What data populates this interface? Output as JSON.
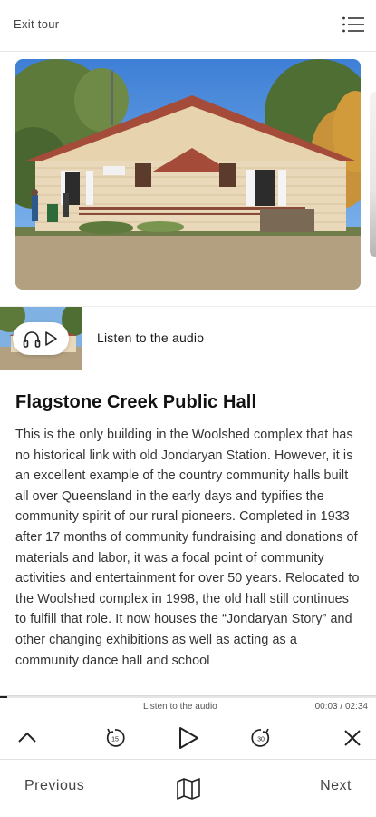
{
  "header": {
    "exit_label": "Exit tour",
    "menu_icon": "hamburger-menu-icon"
  },
  "audio": {
    "listen_label": "Listen to the audio",
    "icons": [
      "headphones-icon",
      "play-icon"
    ]
  },
  "article": {
    "title": "Flagstone Creek Public Hall",
    "body": "This is the only building in the Woolshed complex that has no historical link with old Jondaryan Station. However, it is an excellent example of the country community halls built all over Queensland in the early days and typifies the community spirit of our rural pioneers. Completed in 1933 after 17 months of community fundraising and donations of materials and labor, it was a focal point of community activities and entertainment for over 50 years. Relocated to the Woolshed complex in 1998, the old hall still continues to fulfill that role. It now houses the “Jondaryan Story” and other changing exhibitions as well as acting as a community dance hall and school"
  },
  "player": {
    "label": "Listen to the audio",
    "elapsed": "00:03",
    "separator": " / ",
    "duration": "02:34",
    "progress_fraction": 0.02,
    "icons": [
      "chevron-up-icon",
      "rewind-15-icon",
      "play-icon",
      "forward-30-icon",
      "close-icon"
    ]
  },
  "nav": {
    "previous_label": "Previous",
    "next_label": "Next",
    "map_icon": "map-icon"
  },
  "colors": {
    "text": "#1a1a1a",
    "muted": "#444444",
    "divider": "#e6e6e6"
  }
}
